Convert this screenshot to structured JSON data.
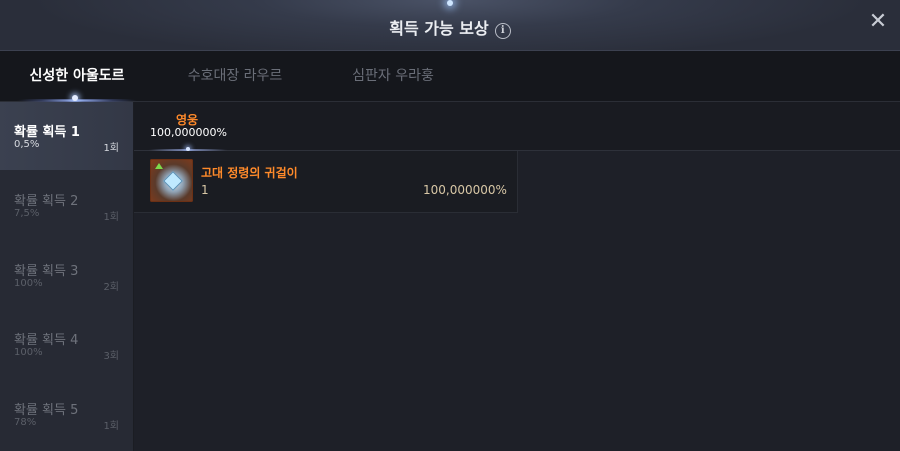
{
  "window": {
    "title": "획득 가능 보상",
    "info_icon": "i",
    "close_icon": "✕"
  },
  "tabs": [
    {
      "label": "신성한 아울도르",
      "active": true
    },
    {
      "label": "수호대장 라우르",
      "active": false
    },
    {
      "label": "심판자 우라훙",
      "active": false
    }
  ],
  "sidebar": {
    "items": [
      {
        "name": "확률 획득 1",
        "rate": "0,5%",
        "count": "1회",
        "active": true
      },
      {
        "name": "확률 획득 2",
        "rate": "7,5%",
        "count": "1회",
        "active": false
      },
      {
        "name": "확률 획득 3",
        "rate": "100%",
        "count": "2회",
        "active": false
      },
      {
        "name": "확률 획득 4",
        "rate": "100%",
        "count": "3회",
        "active": false
      },
      {
        "name": "확률 획득 5",
        "rate": "78%",
        "count": "1회",
        "active": false
      }
    ]
  },
  "grade": {
    "label": "영웅",
    "percent": "100,000000%",
    "color": "#ff8a2a"
  },
  "rewards": [
    {
      "name": "고대 정령의 귀걸이",
      "quantity": "1",
      "percent": "100,000000%",
      "icon": "earring-item-icon"
    }
  ]
}
